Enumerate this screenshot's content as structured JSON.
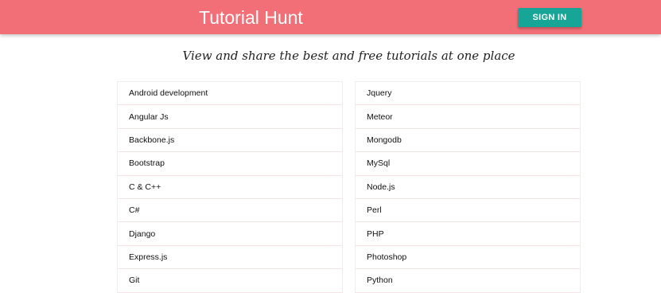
{
  "header": {
    "title": "Tutorial Hunt",
    "sign_in_label": "SIGN IN",
    "background_color": "#f36f77",
    "button_color": "#16a596"
  },
  "tagline": "View and share the best and free tutorials at one place",
  "tutorials": {
    "left": [
      "Android development",
      "Angular Js",
      "Backbone.js",
      "Bootstrap",
      "C & C++",
      "C#",
      "Django",
      "Express.js",
      "Git"
    ],
    "right": [
      "Jquery",
      "Meteor",
      "Mongodb",
      "MySql",
      "Node.js",
      "Perl",
      "PHP",
      "Photoshop",
      "Python"
    ]
  }
}
